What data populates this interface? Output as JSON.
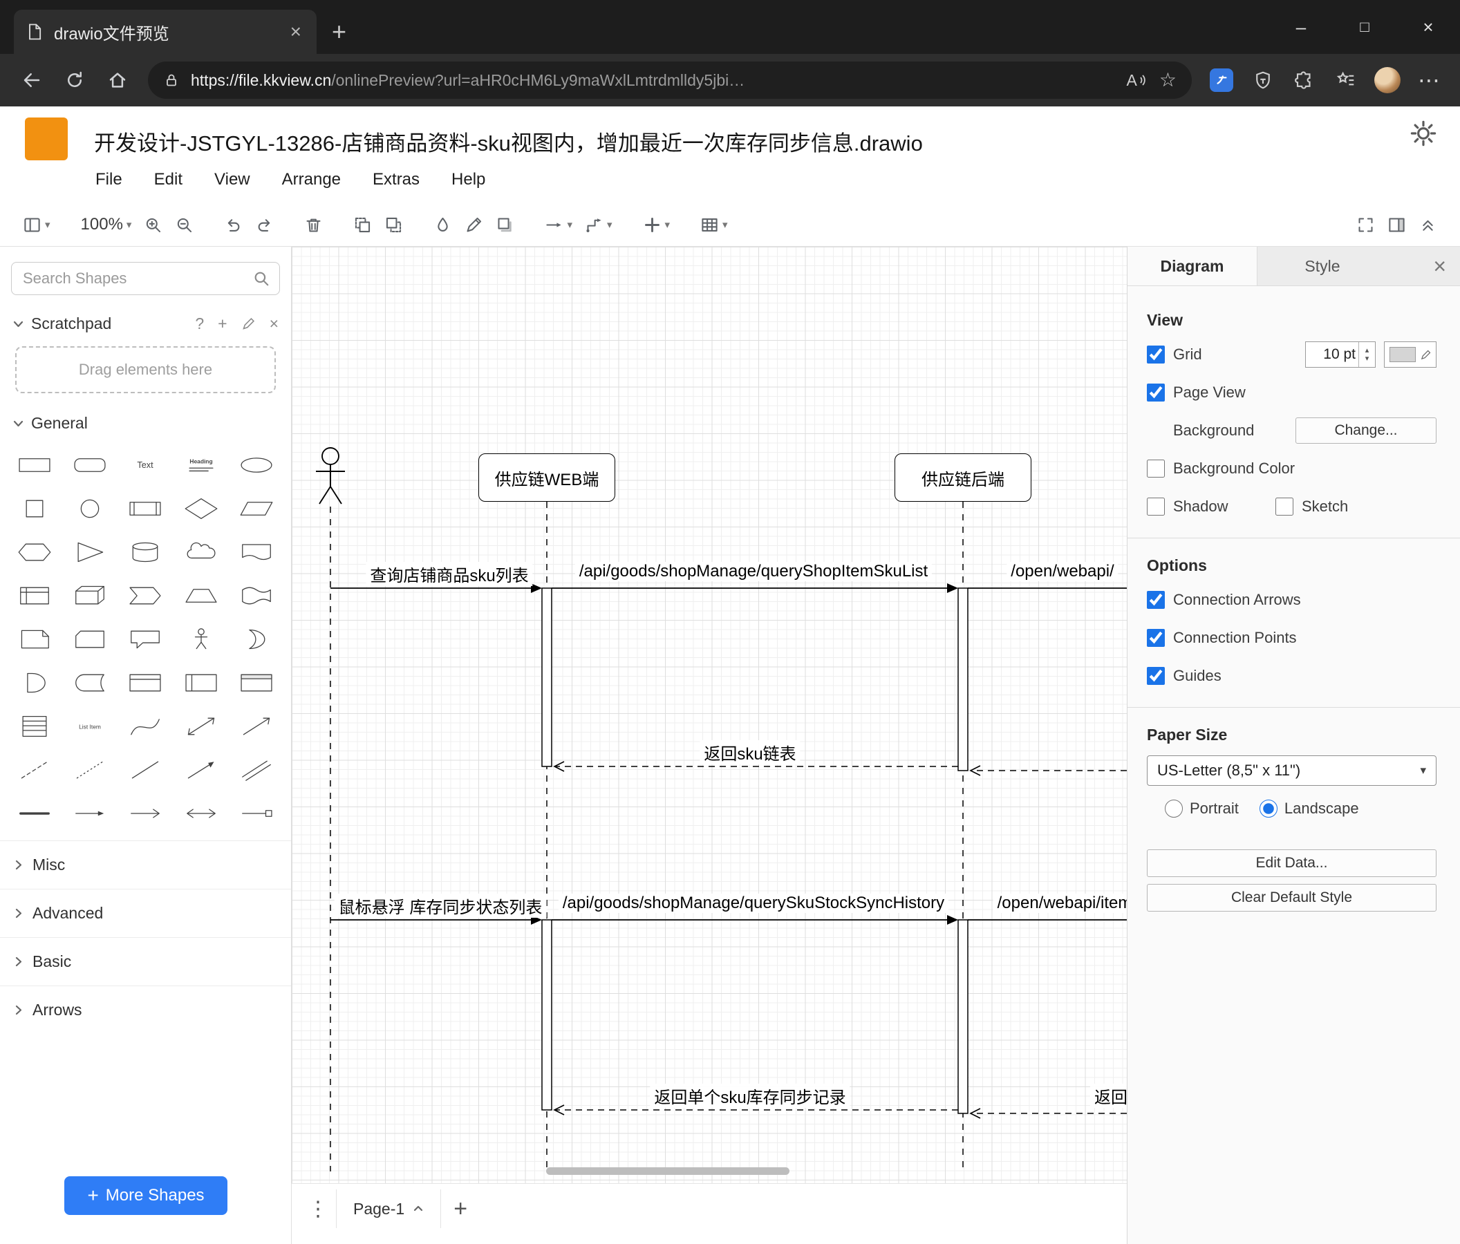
{
  "colors": {
    "accent": "#1a73e8",
    "brand-orange": "#f29111",
    "more-shapes-blue": "#2f7df6",
    "toolbar-icon": "#5f6368",
    "grid-minor": "#efefef",
    "grid-major": "#dedede"
  },
  "browser": {
    "tab_title": "drawio文件预览",
    "url_host": "https://file.kkview.cn",
    "url_path": "/onlinePreview?url=aHR0cHM6Ly9maWxlLmtrdmlldy5jbi…"
  },
  "header": {
    "title": "开发设计-JSTGYL-13286-店铺商品资料-sku视图内，增加最近一次库存同步信息.drawio",
    "menus": [
      "File",
      "Edit",
      "View",
      "Arrange",
      "Extras",
      "Help"
    ]
  },
  "toolbar": {
    "zoom_level": "100%",
    "left_items": [
      "view",
      "zoom-level",
      "zoom-in",
      "zoom-out",
      "undo",
      "redo",
      "delete",
      "to-front",
      "to-back",
      "fill-color",
      "line-color",
      "shadow",
      "connection",
      "waypoints",
      "insert",
      "table"
    ],
    "dropdown_items": [
      "view",
      "zoom-level",
      "connection",
      "waypoints",
      "insert",
      "table"
    ],
    "group_start": [
      "zoom-level",
      "undo",
      "delete",
      "to-front",
      "fill-color",
      "connection",
      "insert",
      "table"
    ],
    "right_items": [
      "fullscreen",
      "format-panel",
      "collapse"
    ]
  },
  "sidebar": {
    "search_placeholder": "Search Shapes",
    "scratchpad_label": "Scratchpad",
    "drag_hint": "Drag elements here",
    "general_label": "General",
    "collapsed_sections": [
      "Misc",
      "Advanced",
      "Basic",
      "Arrows"
    ],
    "more_shapes_label": "More Shapes",
    "shapes": [
      "rectangle",
      "rounded-rectangle",
      "text",
      "heading",
      "ellipse",
      "square",
      "circle",
      "process",
      "diamond",
      "parallelogram",
      "hexagon",
      "triangle",
      "cylinder",
      "cloud",
      "document",
      "internal-storage",
      "cube",
      "step",
      "trapezoid",
      "tape",
      "note",
      "card",
      "callout",
      "actor",
      "or",
      "and",
      "data-storage",
      "container",
      "vertical-container",
      "horizontal-container",
      "list",
      "list-item",
      "curve",
      "bidirectional-arrow",
      "arrow",
      "dashed-line",
      "dotted-line",
      "line",
      "directional-connector",
      "link",
      "horizontal-line",
      "thin-arrow",
      "open-arrow",
      "double-arrow",
      "block-arrow-line"
    ]
  },
  "diagram": {
    "participants": [
      "供应链WEB端",
      "供应链后端"
    ],
    "messages": {
      "query_sku_list": "查询店铺商品sku列表",
      "api_query_shop_item_sku_list": "/api/goods/shopManage/queryShopItemSkuList",
      "open_webapi_1": "/open/webapi/",
      "return_sku_list": "返回sku链表",
      "hover_stock_sync": "鼠标悬浮 库存同步状态列表",
      "api_query_sku_stock_sync_history": "/api/goods/shopManage/querySkuStockSyncHistory",
      "open_webapi_2": "/open/webapi/item",
      "return_single_sku": "返回单个sku库存同步记录",
      "return_partial": "返回"
    }
  },
  "footer": {
    "page_tab": "Page-1"
  },
  "format_panel": {
    "tabs": [
      "Diagram",
      "Style"
    ],
    "view": {
      "heading": "View",
      "grid": "Grid",
      "grid_size": "10",
      "grid_unit": "pt",
      "page_view": "Page View",
      "background": "Background",
      "change": "Change...",
      "background_color": "Background Color",
      "shadow": "Shadow",
      "sketch": "Sketch"
    },
    "options": {
      "heading": "Options",
      "connection_arrows": "Connection Arrows",
      "connection_points": "Connection Points",
      "guides": "Guides"
    },
    "paper": {
      "heading": "Paper Size",
      "size": "US-Letter (8,5\" x 11\")",
      "portrait": "Portrait",
      "landscape": "Landscape"
    },
    "buttons": {
      "edit_data": "Edit Data...",
      "clear_default_style": "Clear Default Style"
    },
    "state": {
      "grid": true,
      "page_view": true,
      "background_color": false,
      "shadow": false,
      "sketch": false,
      "connection_arrows": true,
      "connection_points": true,
      "guides": true,
      "portrait": false,
      "landscape": true
    }
  }
}
